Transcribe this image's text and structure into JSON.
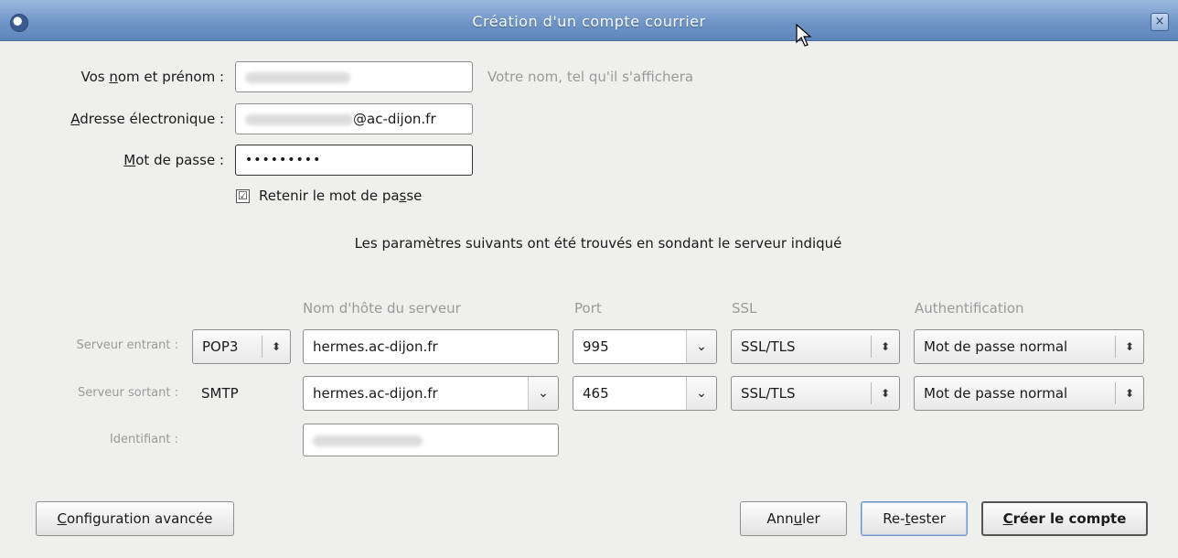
{
  "window": {
    "title": "Création d'un compte courrier",
    "close_glyph": "×"
  },
  "identity": {
    "name_label_pre": "Vos ",
    "name_label_mn": "n",
    "name_label_post": "om et prénom :",
    "name_hint": "Votre nom, tel qu'il s'affichera",
    "email_label_mn": "A",
    "email_label_post": "dresse électronique :",
    "email_domain": "@ac-dijon.fr",
    "password_label_mn": "M",
    "password_label_post": "ot de passe :",
    "password_value": "•••••••••",
    "remember_label_pre": "Retenir le mot de pa",
    "remember_label_mn": "s",
    "remember_label_post": "se",
    "remember_checked": "☑"
  },
  "info_text": "Les paramètres suivants ont été trouvés en sondant le serveur indiqué",
  "columns": {
    "hostname": "Nom d'hôte du serveur",
    "port": "Port",
    "ssl": "SSL",
    "auth": "Authentification"
  },
  "incoming": {
    "label": "Serveur entrant :",
    "protocol": "POP3",
    "hostname": "hermes.ac-dijon.fr",
    "port": "995",
    "ssl": "SSL/TLS",
    "auth": "Mot de passe normal"
  },
  "outgoing": {
    "label": "Serveur sortant :",
    "protocol": "SMTP",
    "hostname": "hermes.ac-dijon.fr",
    "port": "465",
    "ssl": "SSL/TLS",
    "auth": "Mot de passe normal"
  },
  "username_label": "Identifiant :",
  "buttons": {
    "advanced_mn": "C",
    "advanced_post": "onfiguration avancée",
    "cancel_pre": "Ann",
    "cancel_mn": "u",
    "cancel_post": "ler",
    "retest_pre": "Re-",
    "retest_mn": "t",
    "retest_post": "ester",
    "create_mn": "C",
    "create_post": "réer le compte"
  },
  "icons": {
    "spin": "⬍",
    "dropdown": "⌄"
  }
}
